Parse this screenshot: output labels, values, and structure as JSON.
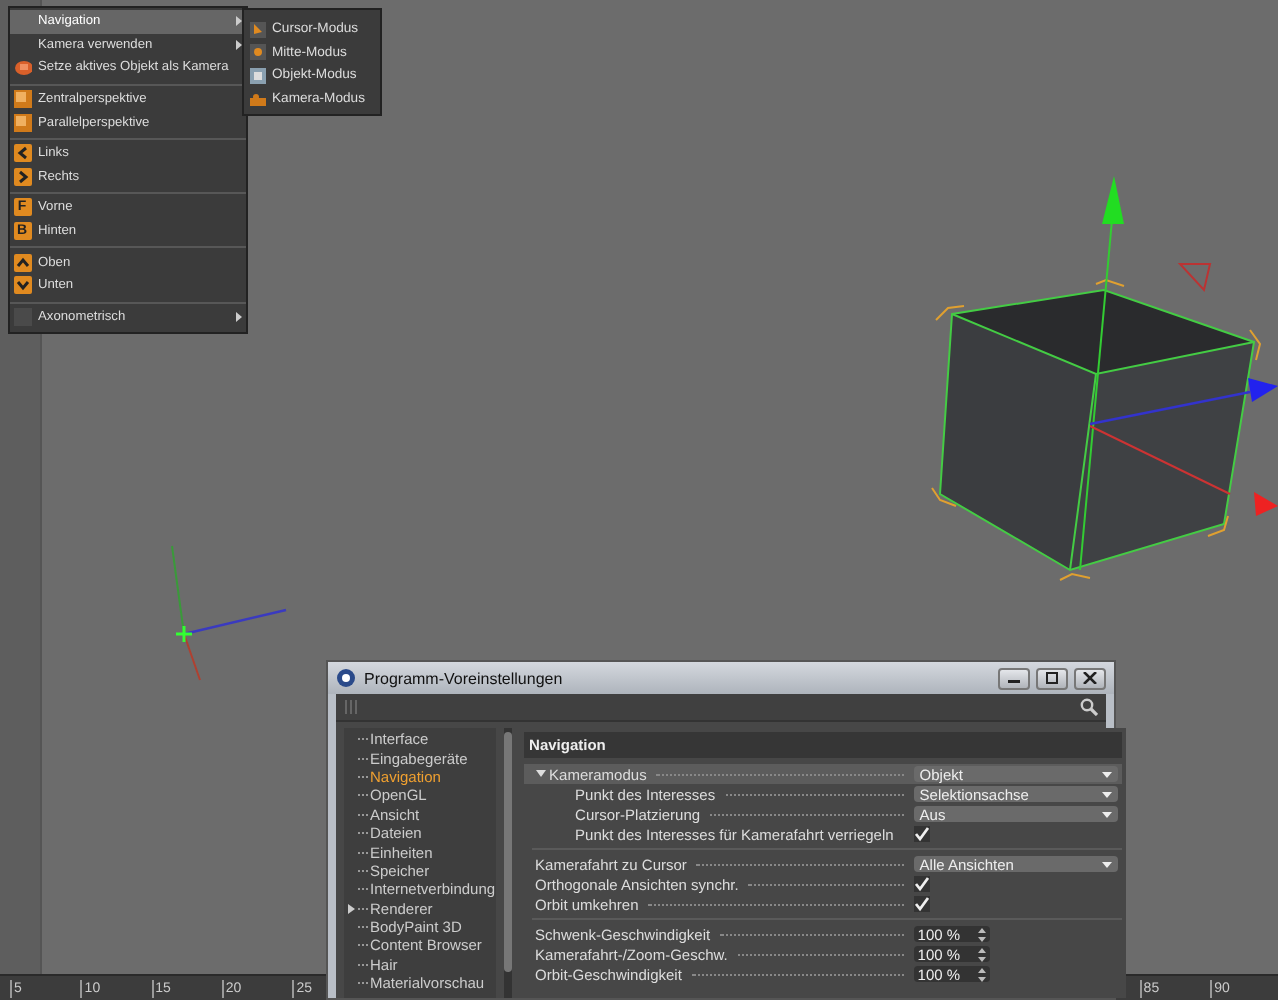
{
  "viewport": {
    "ruler_ticks": [
      "5",
      "10",
      "15",
      "20",
      "25",
      "85",
      "90"
    ]
  },
  "menu": {
    "items": [
      {
        "kind": "item",
        "label": "Navigation",
        "submenu": true,
        "selected": true
      },
      {
        "kind": "item",
        "label": "Kamera verwenden",
        "submenu": true,
        "selected": false
      },
      {
        "kind": "item",
        "label": "Setze aktives Objekt als Kamera",
        "submenu": false,
        "selected": false
      },
      {
        "kind": "separator"
      },
      {
        "kind": "item",
        "label": "Zentralperspektive",
        "submenu": false,
        "selected": false
      },
      {
        "kind": "item",
        "label": "Parallelperspektive",
        "submenu": false,
        "selected": false
      },
      {
        "kind": "separator"
      },
      {
        "kind": "item",
        "label": "Links",
        "submenu": false,
        "selected": false
      },
      {
        "kind": "item",
        "label": "Rechts",
        "submenu": false,
        "selected": false
      },
      {
        "kind": "separator"
      },
      {
        "kind": "item",
        "label": "Vorne",
        "icon_text": "F",
        "submenu": false,
        "selected": false
      },
      {
        "kind": "item",
        "label": "Hinten",
        "icon_text": "B",
        "submenu": false,
        "selected": false
      },
      {
        "kind": "separator"
      },
      {
        "kind": "item",
        "label": "Oben",
        "submenu": false,
        "selected": false
      },
      {
        "kind": "item",
        "label": "Unten",
        "submenu": false,
        "selected": false
      },
      {
        "kind": "separator"
      },
      {
        "kind": "item",
        "label": "Axonometrisch",
        "submenu": true,
        "selected": false
      }
    ]
  },
  "submenu": {
    "items": [
      {
        "label": "Cursor-Modus"
      },
      {
        "label": "Mitte-Modus"
      },
      {
        "label": "Objekt-Modus"
      },
      {
        "label": "Kamera-Modus"
      }
    ]
  },
  "dialog": {
    "title": "Programm-Voreinstellungen",
    "tree": [
      {
        "label": "Interface",
        "selected": false
      },
      {
        "label": "Eingabegeräte",
        "selected": false
      },
      {
        "label": "Navigation",
        "selected": true
      },
      {
        "label": "OpenGL",
        "selected": false
      },
      {
        "label": "Ansicht",
        "selected": false
      },
      {
        "label": "Dateien",
        "selected": false
      },
      {
        "label": "Einheiten",
        "selected": false
      },
      {
        "label": "Speicher",
        "selected": false
      },
      {
        "label": "Internetverbindung",
        "selected": false
      },
      {
        "label": "Renderer",
        "selected": false,
        "expanded": false
      },
      {
        "label": "BodyPaint 3D",
        "selected": false
      },
      {
        "label": "Content Browser",
        "selected": false
      },
      {
        "label": "Hair",
        "selected": false
      },
      {
        "label": "Materialvorschau",
        "selected": false
      }
    ],
    "section": "Navigation",
    "settings": [
      {
        "kind": "dropdown",
        "label": "Kameramodus",
        "value": "Objekt",
        "expanded": true,
        "selected": true,
        "children": [
          {
            "kind": "dropdown",
            "label": "Punkt des Interesses",
            "value": "Selektionsachse",
            "selected": false
          },
          {
            "kind": "dropdown",
            "label": "Cursor-Platzierung",
            "value": "Aus",
            "selected": false
          },
          {
            "kind": "checkbox",
            "label": "Punkt des Interesses für Kamerafahrt verriegeln",
            "checked": true,
            "selected": false
          }
        ]
      },
      {
        "kind": "separator"
      },
      {
        "kind": "dropdown",
        "label": "Kamerafahrt zu Cursor",
        "value": "Alle Ansichten",
        "selected": false
      },
      {
        "kind": "checkbox",
        "label": "Orthogonale Ansichten synchr.",
        "checked": true,
        "selected": false
      },
      {
        "kind": "checkbox",
        "label": "Orbit umkehren",
        "checked": true,
        "selected": false
      },
      {
        "kind": "separator"
      },
      {
        "kind": "number",
        "label": "Schwenk-Geschwindigkeit",
        "value": "100 %",
        "selected": false
      },
      {
        "kind": "number",
        "label": "Kamerafahrt-/Zoom-Geschw.",
        "value": "100 %",
        "selected": false
      },
      {
        "kind": "number",
        "label": "Orbit-Geschwindigkeit",
        "value": "100 %",
        "selected": false
      }
    ]
  }
}
